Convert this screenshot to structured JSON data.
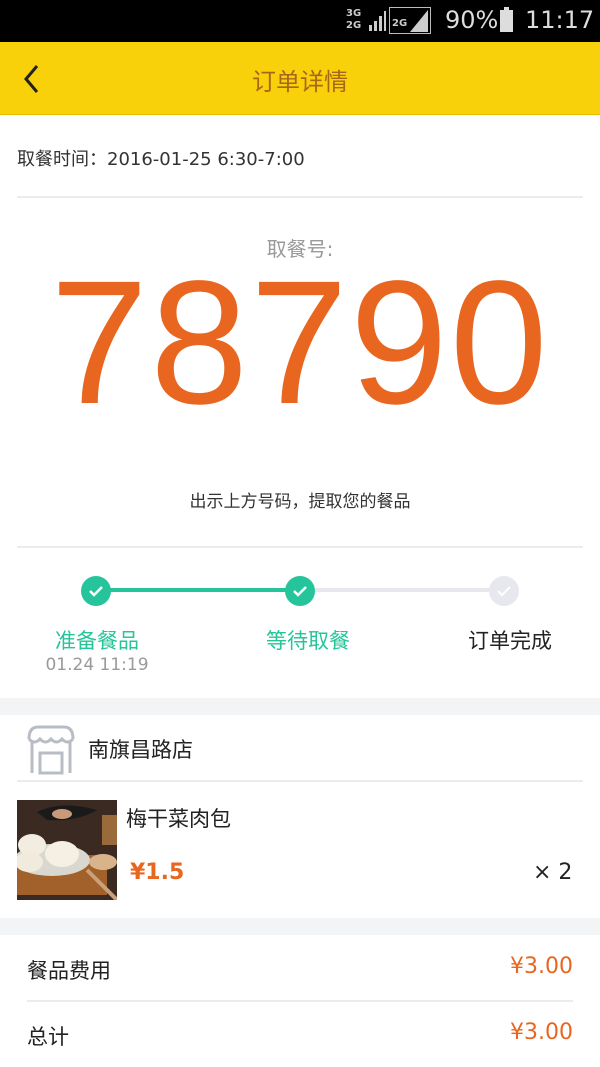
{
  "status_bar": {
    "network_top": "3G",
    "network_bottom": "2G",
    "sim2_network": "2G",
    "battery_percent": "90%",
    "time": "11:17"
  },
  "nav": {
    "back_icon": "chevron-left-icon",
    "title": "订单详情"
  },
  "pickup": {
    "time_label": "取餐时间：",
    "time_value": "2016-01-25 6:30-7:00",
    "code_label": "取餐号:",
    "code": "78790",
    "hint": "出示上方号码，提取您的餐品"
  },
  "progress": {
    "steps": [
      {
        "label": "准备餐品",
        "time": "01.24 11:19",
        "done": true
      },
      {
        "label": "等待取餐",
        "time": "",
        "done": true
      },
      {
        "label": "订单完成",
        "time": "",
        "done": false
      }
    ],
    "colors": {
      "active": "#26c49a",
      "inactive": "#e6e8ee"
    }
  },
  "store": {
    "icon": "store-icon",
    "name": "南旗昌路店"
  },
  "items": [
    {
      "name": "梅干菜肉包",
      "price": "¥1.5",
      "quantity": "× 2"
    }
  ],
  "summary": {
    "rows": [
      {
        "label": "餐品费用",
        "value": "¥3.00"
      },
      {
        "label": "总计",
        "value": "¥3.00"
      }
    ]
  },
  "colors": {
    "brand": "#f8d10a",
    "accent": "#e8661f",
    "success": "#26c49a"
  }
}
